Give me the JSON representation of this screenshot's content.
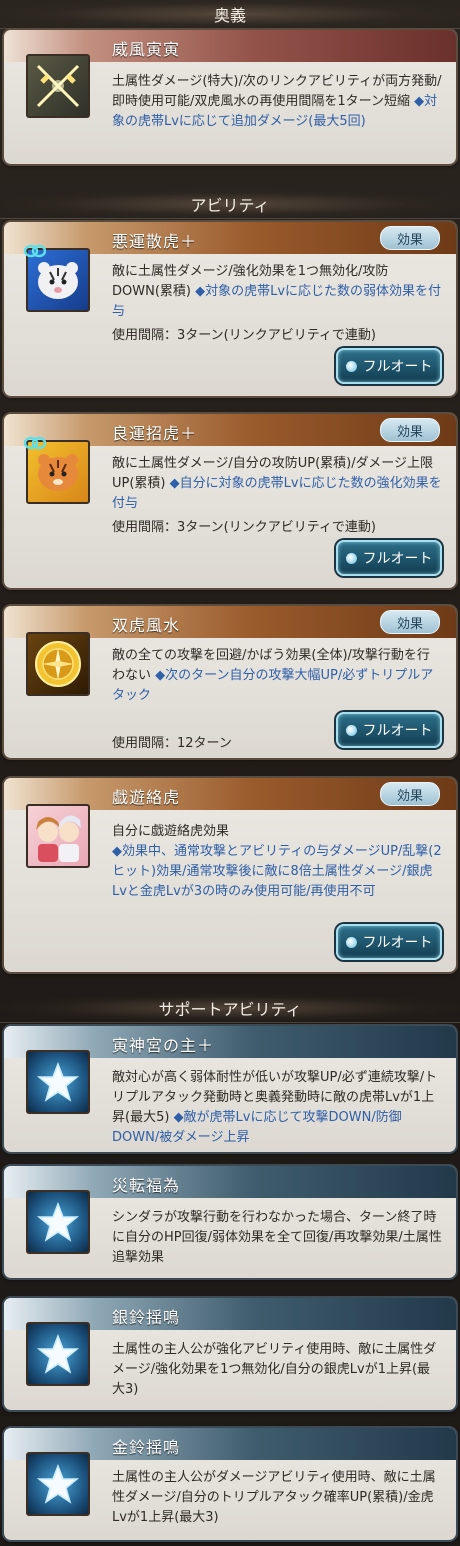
{
  "sections": {
    "ougi": "奥義",
    "abilities": "アビリティ",
    "support": "サポートアビリティ"
  },
  "ougi": {
    "title": "威風寅寅",
    "desc": "土属性ダメージ(特大)/次のリンクアビリティが両方発動/即時使用可能/双虎風水の再使用間隔を1ターン短縮",
    "extra": "◆対象の虎帯Lvに応じて追加ダメージ(最大5回)"
  },
  "abilities": [
    {
      "title": "悪運散虎＋",
      "badge": "効果",
      "desc": "敵に土属性ダメージ/強化効果を1つ無効化/攻防DOWN(累積)",
      "extra": "◆対象の虎帯Lvに応じた数の弱体効果を付与",
      "interval": "使用間隔：3ターン(リンクアビリティで連動)",
      "button": "フルオート"
    },
    {
      "title": "良運招虎＋",
      "badge": "効果",
      "desc": "敵に土属性ダメージ/自分の攻防UP(累積)/ダメージ上限UP(累積)",
      "extra": "◆自分に対象の虎帯Lvに応じた数の強化効果を付与",
      "interval": "使用間隔：3ターン(リンクアビリティで連動)",
      "button": "フルオート"
    },
    {
      "title": "双虎風水",
      "badge": "効果",
      "desc": "敵の全ての攻撃を回避/かばう効果(全体)/攻撃行動を行わない",
      "extra": "◆次のターン自分の攻撃大幅UP/必ずトリプルアタック",
      "interval": "使用間隔：12ターン",
      "button": "フルオート"
    },
    {
      "title": "戯遊絡虎",
      "badge": "効果",
      "desc": "自分に戯遊絡虎効果",
      "extra": "◆効果中、通常攻撃とアビリティの与ダメージUP/乱撃(2ヒット)効果/通常攻撃後に敵に8倍土属性ダメージ/銀虎Lvと金虎Lvが3の時のみ使用可能/再使用不可",
      "interval": "",
      "button": "フルオート"
    }
  ],
  "support": [
    {
      "title": "寅神宮の主＋",
      "desc": "敵対心が高く弱体耐性が低いが攻撃UP/必ず連続攻撃/トリプルアタック発動時と奥義発動時に敵の虎帯Lvが1上昇(最大5)",
      "extra": "◆敵が虎帯Lvに応じて攻撃DOWN/防御DOWN/被ダメージ上昇"
    },
    {
      "title": "災転福為",
      "desc": "シンダラが攻撃行動を行わなかった場合、ターン終了時に自分のHP回復/弱体効果を全て回復/再攻撃効果/土属性追撃効果",
      "extra": ""
    },
    {
      "title": "銀鈴揺鳴",
      "desc": "土属性の主人公が強化アビリティ使用時、敵に土属性ダメージ/強化効果を1つ無効化/自分の銀虎Lvが1上昇(最大3)",
      "extra": ""
    },
    {
      "title": "金鈴揺鳴",
      "desc": "土属性の主人公がダメージアビリティ使用時、敵に土属性ダメージ/自分のトリプルアタック確率UP(累積)/金虎Lvが1上昇(最大3)",
      "extra": ""
    }
  ],
  "icons": {
    "ougi": "crossed-swords-icon",
    "ability1": "white-tiger-icon",
    "ability2": "orange-tiger-icon",
    "ability3": "golden-compass-icon",
    "ability4": "character-portrait-icon",
    "support": "star-icon",
    "link": "link-chain-icon"
  }
}
